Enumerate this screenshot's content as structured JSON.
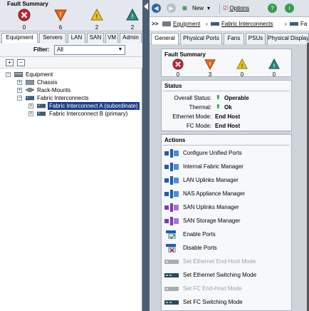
{
  "left_panel": {
    "fault_summary": {
      "title": "Fault Summary",
      "counts": [
        {
          "icon": "critical-icon",
          "value": "0",
          "color": "#c0272d"
        },
        {
          "icon": "major-icon",
          "value": "6",
          "color": "#e46a1d"
        },
        {
          "icon": "minor-icon",
          "value": "2",
          "color": "#e8c21b"
        },
        {
          "icon": "warning-icon",
          "value": "2",
          "color": "#2a8a7f"
        }
      ]
    },
    "tabs": [
      "Equipment",
      "Servers",
      "LAN",
      "SAN",
      "VM",
      "Admin"
    ],
    "filter": {
      "label": "Filter:",
      "value": "All"
    },
    "tree": {
      "root": "Equipment",
      "chassis": "Chassis",
      "rack_mounts": "Rack-Mounts",
      "fabric_interconnects": "Fabric Interconnects",
      "fi_a": "Fabric Interconnect A (subordinate)",
      "fi_b": "Fabric Interconnect B (primary)"
    }
  },
  "right_panel": {
    "toolbar": {
      "new_label": "New",
      "new_arrow": "▾",
      "options_label": "Options"
    },
    "breadcrumb": {
      "prefix": ">>",
      "items": [
        "Equipment",
        "Fabric Interconnects",
        "Fa"
      ]
    },
    "tabs": [
      "General",
      "Physical Ports",
      "Fans",
      "PSUs",
      "Physical Display"
    ],
    "fault_summary": {
      "title": "Fault Summary",
      "counts": [
        {
          "icon": "critical-icon",
          "value": "0",
          "color": "#c0272d"
        },
        {
          "icon": "major-icon",
          "value": "3",
          "color": "#e46a1d"
        },
        {
          "icon": "minor-icon",
          "value": "0",
          "color": "#e8c21b"
        },
        {
          "icon": "warning-icon",
          "value": "0",
          "color": "#2a8a7f"
        }
      ]
    },
    "status": {
      "title": "Status",
      "overall_label": "Overall Status:",
      "overall_value": "Operable",
      "thermal_label": "Thermal:",
      "thermal_value": "Ok",
      "eth_mode_label": "Ethernet Mode:",
      "eth_mode_value": "End Host",
      "fc_mode_label": "FC Mode:",
      "fc_mode_value": "End Host"
    },
    "actions": {
      "title": "Actions",
      "items": [
        {
          "label": "Configure Unified Ports",
          "icon": "unified-ports-icon",
          "enabled": true
        },
        {
          "label": "Internal Fabric Manager",
          "icon": "fabric-manager-icon",
          "enabled": true
        },
        {
          "label": "LAN Uplinks Manager",
          "icon": "lan-uplinks-icon",
          "enabled": true
        },
        {
          "label": "NAS Appliance Manager",
          "icon": "nas-appliance-icon",
          "enabled": true
        },
        {
          "label": "SAN Uplinks Manager",
          "icon": "san-uplinks-icon",
          "enabled": true
        },
        {
          "label": "SAN Storage Manager",
          "icon": "san-storage-icon",
          "enabled": true
        },
        {
          "label": "Enable Ports",
          "icon": "enable-ports-icon",
          "enabled": true
        },
        {
          "label": "Disable Ports",
          "icon": "disable-ports-icon",
          "enabled": true
        },
        {
          "label": "Set Ethernet End-Host Mode",
          "icon": "ethernet-endhost-icon",
          "enabled": false
        },
        {
          "label": "Set Ethernet Switching Mode",
          "icon": "ethernet-switching-icon",
          "enabled": true
        },
        {
          "label": "Set FC End-Host Mode",
          "icon": "fc-endhost-icon",
          "enabled": false
        },
        {
          "label": "Set FC Switching Mode",
          "icon": "fc-switching-icon",
          "enabled": true
        }
      ]
    }
  }
}
